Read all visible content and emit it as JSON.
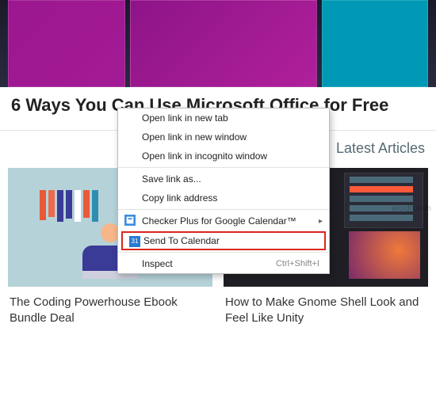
{
  "main_article_title": "6 Ways You Can Use Microsoft Office for Free",
  "section_heading": "Latest Articles",
  "cards": [
    {
      "title": "The Coding Powerhouse Ebook Bundle Deal"
    },
    {
      "title": "How to Make Gnome Shell Look and Feel Like Unity"
    }
  ],
  "context_menu": {
    "open_new_tab": "Open link in new tab",
    "open_new_window": "Open link in new window",
    "open_incognito": "Open link in incognito window",
    "save_link_as": "Save link as...",
    "copy_link": "Copy link address",
    "checker_plus": "Checker Plus for Google Calendar™",
    "send_to_calendar": "Send To Calendar",
    "inspect": "Inspect",
    "inspect_shortcut": "Ctrl+Shift+I",
    "cal_icon_text": "31"
  },
  "watermark": "wsxdn.com"
}
